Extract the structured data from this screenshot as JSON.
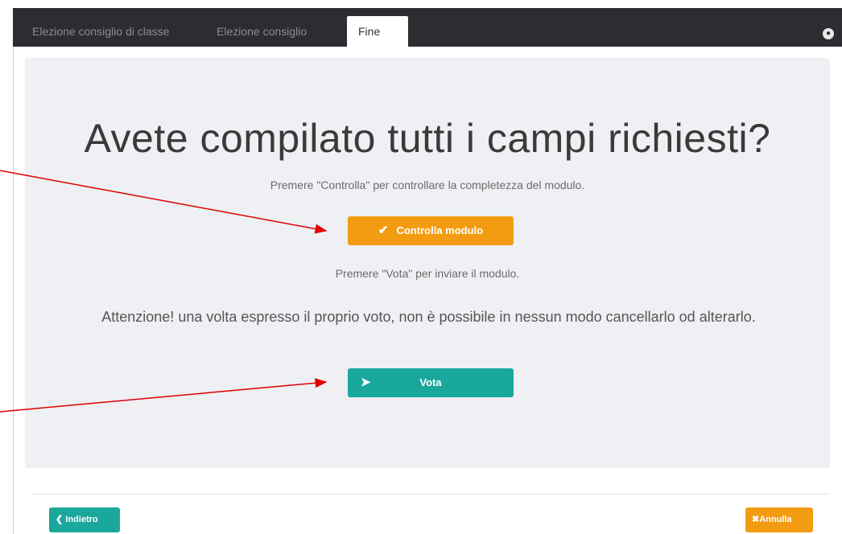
{
  "tabs": [
    {
      "label": "Elezione consiglio di classe"
    },
    {
      "label": "Elezione consiglio"
    },
    {
      "label": "Fine"
    }
  ],
  "main": {
    "heading": "Avete compilato tutti i campi richiesti?",
    "check_hint": "Premere \"Controlla\" per controllare la completezza del modulo.",
    "check_button": "Controlla modulo",
    "vote_hint": "Premere \"Vota\" per inviare il modulo.",
    "warning": "Attenzione! una volta espresso il proprio voto, non è possibile in nessun modo cancellarlo od alterarlo.",
    "vote_button": "Vota"
  },
  "footer": {
    "back_button": "Indietro",
    "cancel_button": "Annulla"
  },
  "colors": {
    "orange": "#f39c12",
    "teal": "#1aa79c",
    "topbar": "#2b2d31",
    "arrow": "#e00000"
  },
  "icons": {
    "check": "check-icon",
    "send": "paper-plane-icon",
    "back": "circle-arrow-left-icon",
    "cancel": "times-icon",
    "globe": "globe-icon"
  }
}
